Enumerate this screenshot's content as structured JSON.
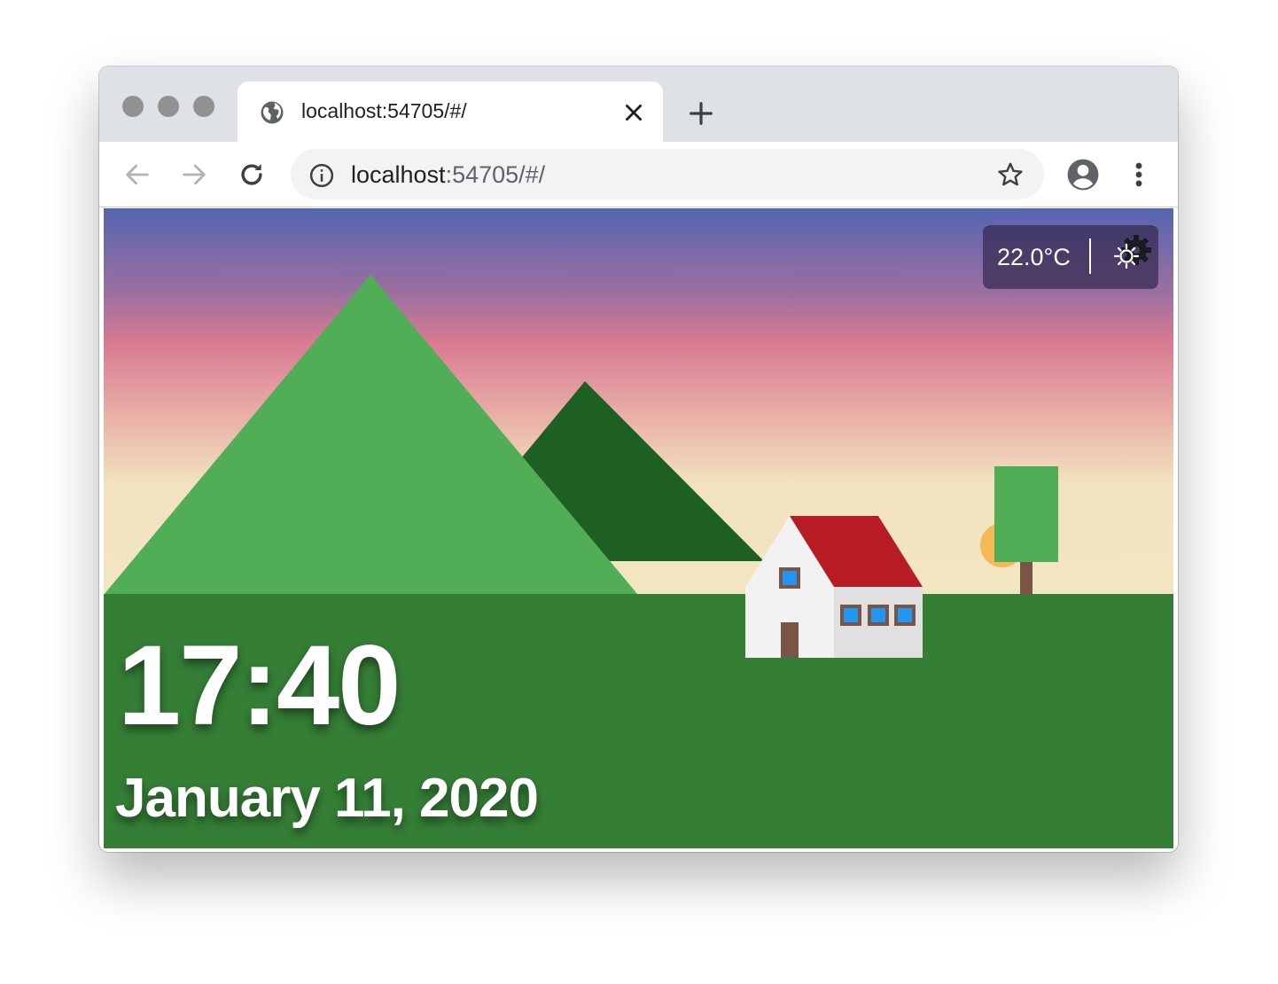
{
  "browser": {
    "tab": {
      "title": "localhost:54705/#/",
      "favicon": "globe-icon"
    },
    "address": {
      "host": "localhost",
      "rest": ":54705/#/"
    },
    "icons": {
      "back": "arrow-left-icon",
      "forward": "arrow-right-icon",
      "reload": "reload-icon",
      "info": "info-icon",
      "bookmark": "star-icon",
      "profile": "account-icon",
      "menu": "more-vert-icon",
      "close_tab": "close-icon",
      "new_tab": "plus-icon"
    }
  },
  "app": {
    "time": "17:40",
    "date": "January 11, 2020",
    "weather": {
      "temperature": "22.0°C",
      "icon": "sun-gear-icon"
    }
  },
  "colors": {
    "sky_top": "#5565b1",
    "sky_mid": "#d97a92",
    "sky_bottom": "#f2e6c1",
    "mountain_front": "#52ae56",
    "mountain_back": "#1e5f24",
    "grass": "#357e36",
    "roof": "#b71c24",
    "house_wall": "#f2f2f2",
    "window": "#2196f3",
    "sun": "#f6b958"
  }
}
